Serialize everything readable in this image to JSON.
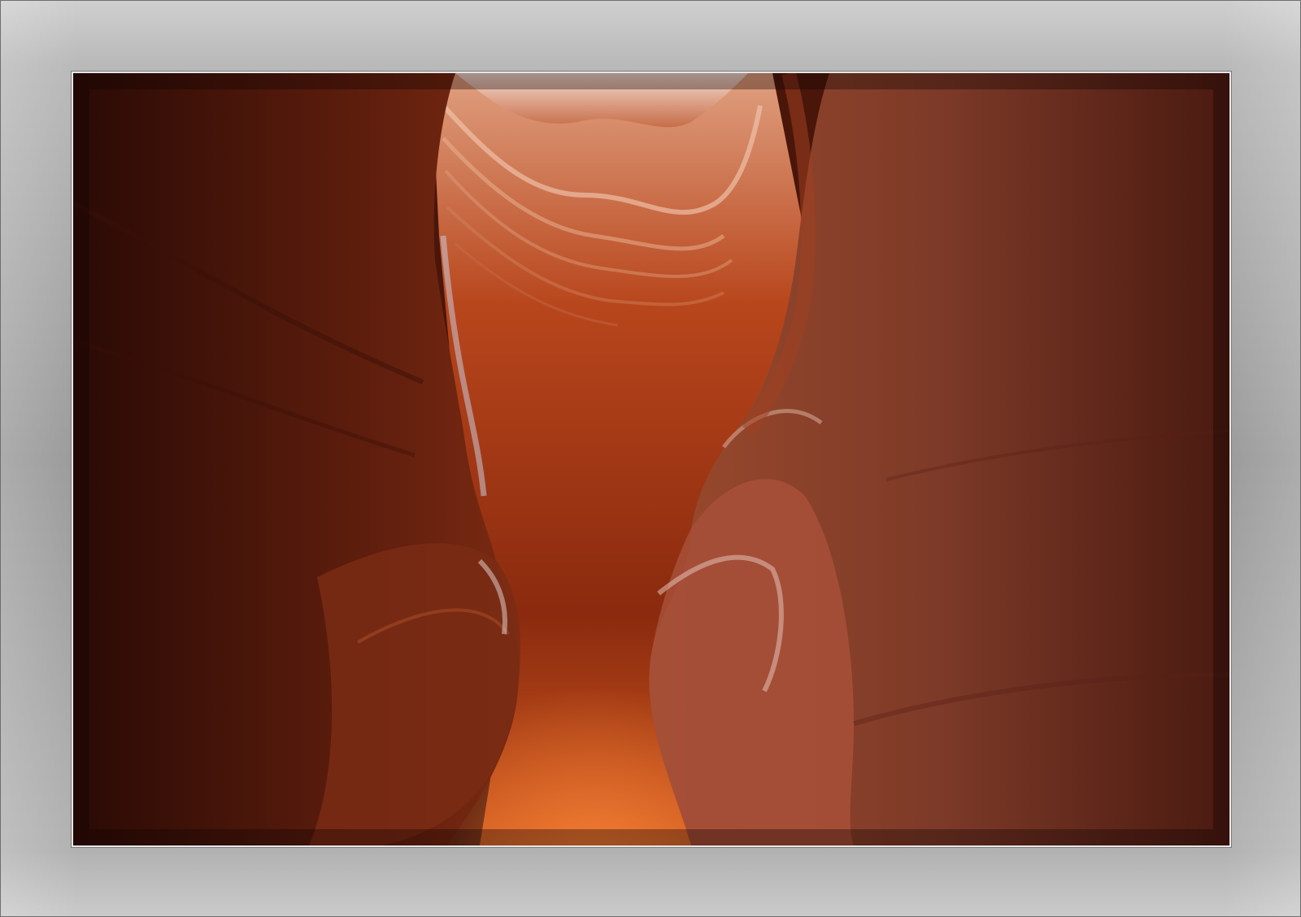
{
  "image": {
    "subject": "slot-canyon-photograph",
    "colors": {
      "frame_light": "#cfcfcf",
      "frame_mid": "#9a9a9a",
      "rock_dark": "#3a0f08",
      "rock_mid": "#8a2f12",
      "rock_bright": "#d9652a",
      "highlight": "#f0c2a0"
    }
  }
}
